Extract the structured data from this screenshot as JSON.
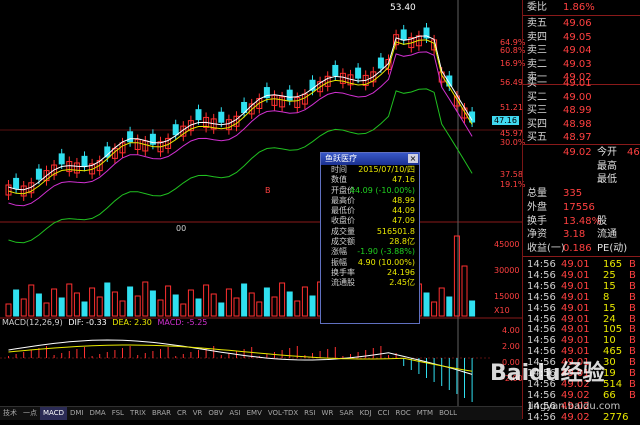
{
  "main_chart": {
    "price_high_label": "53.40",
    "right_axis_labels": [
      "64.9%",
      "60.8%",
      "56.49",
      "51.21",
      "45.97",
      "37.58",
      "19.1%",
      "30.0%",
      "16.9%"
    ],
    "current_price_tag": "47.16",
    "marker_label": "B"
  },
  "volume_panel": {
    "header_value": "00",
    "axis_labels": [
      "45000",
      "30000",
      "15000",
      "X10"
    ]
  },
  "macd_panel": {
    "title": "MACD(12,26,9)",
    "dif_label": "DIF: -0.33",
    "dea_label": "DEA: 2.30",
    "macd_label": "MACD: -5.25",
    "axis_labels": [
      "4.00",
      "2.00",
      "0.00",
      "-2.00"
    ]
  },
  "popup": {
    "title": "鱼跃医疗",
    "rows": [
      {
        "label": "时间",
        "value": "2015/07/10/四"
      },
      {
        "label": "数值",
        "value": "47.16"
      },
      {
        "label": "开盘价",
        "value": "44.09 (-10.00%)"
      },
      {
        "label": "最高价",
        "value": "48.99"
      },
      {
        "label": "最低价",
        "value": "44.09"
      },
      {
        "label": "收盘价",
        "value": "47.09"
      },
      {
        "label": "成交量",
        "value": "516501.8"
      },
      {
        "label": "成交额",
        "value": "28.8亿"
      },
      {
        "label": "涨幅",
        "value": "-1.90 (-3.88%)"
      },
      {
        "label": "振幅",
        "value": "4.90 (10.00%)"
      },
      {
        "label": "换手率",
        "value": "24.196"
      },
      {
        "label": "流通股",
        "value": "2.45亿"
      }
    ]
  },
  "order_book": {
    "header_label": "委比",
    "header_value": "1.86%",
    "asks": [
      {
        "label": "卖五",
        "price": "49.06"
      },
      {
        "label": "卖四",
        "price": "49.05"
      },
      {
        "label": "卖三",
        "price": "49.04"
      },
      {
        "label": "卖二",
        "price": "49.03"
      },
      {
        "label": "卖一",
        "price": "49.02"
      }
    ],
    "bids": [
      {
        "label": "买一",
        "price": "49.01"
      },
      {
        "label": "买二",
        "price": "49.00"
      },
      {
        "label": "买三",
        "price": "48.99"
      },
      {
        "label": "买四",
        "price": "48.98"
      },
      {
        "label": "买五",
        "price": "48.97"
      }
    ]
  },
  "quote": [
    {
      "l1": "",
      "v1": "49.02",
      "l2": "今开",
      "v2": "46."
    },
    {
      "l1": "",
      "v1": "",
      "l2": "最高",
      "v2": ""
    },
    {
      "l1": "",
      "v1": "",
      "l2": "最低",
      "v2": ""
    },
    {
      "l1": "总量",
      "v1": "335",
      "l2": "",
      "v2": ""
    },
    {
      "l1": "外盘",
      "v1": "17556",
      "l2": "",
      "v2": ""
    },
    {
      "l1": "换手",
      "v1": "13.48%",
      "l2": "股",
      "v2": ""
    },
    {
      "l1": "净资",
      "v1": "3.18",
      "l2": "流通",
      "v2": ""
    },
    {
      "l1": "收益(一)",
      "v1": "0.186",
      "l2": "PE(动)",
      "v2": ""
    }
  ],
  "ticks": [
    {
      "time": "14:56",
      "price": "49.01",
      "vol": "165",
      "side": "B"
    },
    {
      "time": "14:56",
      "price": "49.01",
      "vol": "25",
      "side": "B"
    },
    {
      "time": "14:56",
      "price": "49.01",
      "vol": "15",
      "side": "B"
    },
    {
      "time": "14:56",
      "price": "49.01",
      "vol": "8",
      "side": "B"
    },
    {
      "time": "14:56",
      "price": "49.01",
      "vol": "15",
      "side": "B"
    },
    {
      "time": "14:56",
      "price": "49.01",
      "vol": "24",
      "side": "B"
    },
    {
      "time": "14:56",
      "price": "49.01",
      "vol": "105",
      "side": "B"
    },
    {
      "time": "14:56",
      "price": "49.01",
      "vol": "10",
      "side": "B"
    },
    {
      "time": "14:56",
      "price": "49.01",
      "vol": "465",
      "side": "B"
    },
    {
      "time": "14:56",
      "price": "49.01",
      "vol": "30",
      "side": "B"
    },
    {
      "time": "14:56",
      "price": "49.01",
      "vol": "19",
      "side": "B"
    },
    {
      "time": "14:56",
      "price": "49.02",
      "vol": "514",
      "side": "B"
    },
    {
      "time": "14:56",
      "price": "49.02",
      "vol": "66",
      "side": "B"
    },
    {
      "time": "14:56",
      "price": "49.02",
      "vol": "",
      "side": ""
    },
    {
      "time": "14:56",
      "price": "49.02",
      "vol": "2776",
      "side": ""
    }
  ],
  "tabs": [
    "技术",
    "一点",
    "MACD",
    "DMI",
    "DMA",
    "FSL",
    "TRIX",
    "BRAR",
    "CR",
    "VR",
    "OBV",
    "ASI",
    "EMV",
    "VOL-TDX",
    "RSI",
    "WR",
    "SAR",
    "KDJ",
    "CCI",
    "ROC",
    "MTM",
    "BOLL"
  ],
  "active_tab": "MACD",
  "watermark": {
    "brand": "Baidu经验",
    "url": "jingyan.baidu.com"
  },
  "colors": {
    "up": "#ff3030",
    "down": "#30e0f0",
    "ma5": "#ffffff",
    "ma10": "#e8e800",
    "ma20": "#d030d0",
    "ma60": "#20c020",
    "grid_red": "#8a1a1a"
  }
}
